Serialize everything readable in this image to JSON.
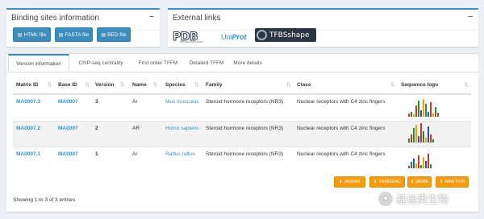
{
  "binding": {
    "title": "Binding sites information",
    "collapse": "−",
    "buttons": [
      {
        "label": "HTML file",
        "icon": "file-icon"
      },
      {
        "label": "FASTA file",
        "icon": "file-icon"
      },
      {
        "label": "BED file",
        "icon": "file-icon"
      }
    ]
  },
  "external": {
    "title": "External links",
    "collapse": "−",
    "pdb": {
      "letters": "PDB",
      "sub": "PROTEIN DATA BANK"
    },
    "uniprot": {
      "uni": "Uni",
      "prot": "Prot"
    },
    "tfbs": {
      "text": "TFBSshape"
    }
  },
  "tabs": [
    {
      "label": "Version information",
      "active": true
    },
    {
      "label": "ChIP-seq centrality"
    },
    {
      "label": "First order TFFM"
    },
    {
      "label": "Detailed TFFM"
    },
    {
      "label": "More details"
    }
  ],
  "table": {
    "columns": [
      "Matrix ID",
      "Base ID",
      "Version",
      "Name",
      "Species",
      "Family",
      "Class",
      "Sequence logo"
    ],
    "sort_icon": "⇅",
    "rows": [
      {
        "matrix_id": "MA0007.3",
        "base_id": "MA0007",
        "version": "3",
        "name": "Ar",
        "species": "Mus musculus",
        "family": "Steroid hormone receptors (NR3)",
        "class": "Nuclear receptors with C4 zinc fingers"
      },
      {
        "matrix_id": "MA0007.2",
        "base_id": "MA0007",
        "version": "2",
        "name": "AR",
        "species": "Homo sapiens",
        "family": "Steroid hormone receptors (NR3)",
        "class": "Nuclear receptors with C4 zinc fingers"
      },
      {
        "matrix_id": "MA0007.1",
        "base_id": "MA0007",
        "version": "1",
        "name": "Ar",
        "species": "Rattus rattus",
        "family": "Steroid hormone receptors (NR3)",
        "class": "Nuclear receptors with C4 zinc fingers"
      }
    ]
  },
  "export_buttons": [
    {
      "label": "JASPAR",
      "icon": "download-icon"
    },
    {
      "label": "TRANSFAC",
      "icon": "download-icon"
    },
    {
      "label": "MEME",
      "icon": "download-icon"
    },
    {
      "label": "RAW PFM",
      "icon": "download-icon"
    }
  ],
  "entries_text": "Showing 1 to 3 of 3 entries",
  "watermark": {
    "text": "基迪奥生物"
  },
  "colors": {
    "primary": "#3c8dbc",
    "warning": "#f39c12",
    "background": "#ecf0f5"
  }
}
